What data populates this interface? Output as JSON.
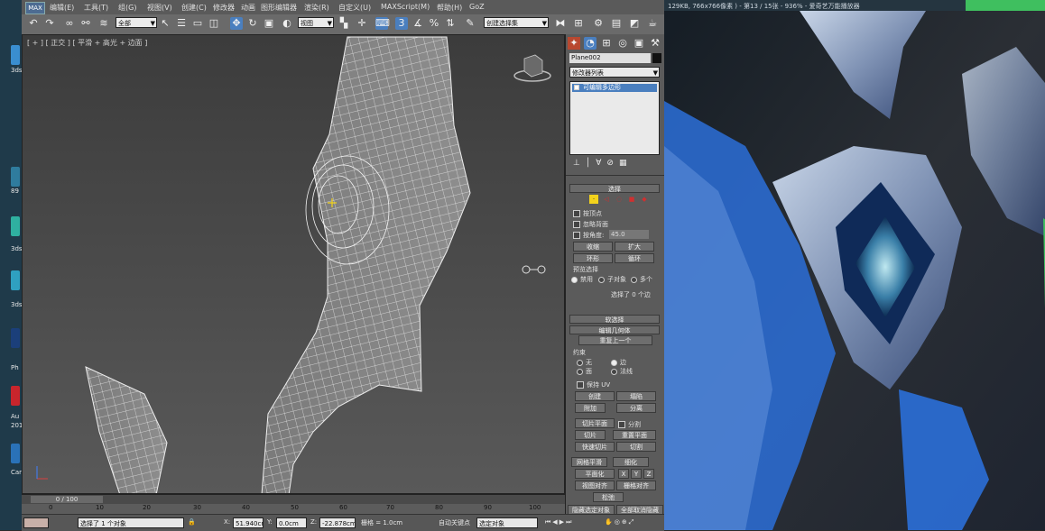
{
  "menubar": {
    "logo": "MAX",
    "items": [
      "编辑(E)",
      "工具(T)",
      "组(G)",
      "视图(V)",
      "创建(C)",
      "修改器",
      "动画",
      "图形编辑器",
      "渲染(R)",
      "自定义(U)",
      "MAXScript(M)",
      "帮助(H)",
      "GoZ"
    ]
  },
  "toolbar": {
    "filter_value": "全部",
    "refcoord_value": "视图",
    "selset_value": "创建选择集"
  },
  "viewport": {
    "label": "[ + ] [ 正交 ] [ 平滑 + 高光 + 边面 ]"
  },
  "timeline": {
    "frame_label": "0 / 100",
    "ticks": [
      "0",
      "10",
      "20",
      "30",
      "40",
      "50",
      "60",
      "70",
      "80",
      "90",
      "100"
    ]
  },
  "status": {
    "selected_text": "选择了 1 个对象",
    "x_label": "X:",
    "x_value": "51.940cm",
    "y_label": "Y:",
    "y_value": "0.0cm",
    "z_label": "Z:",
    "z_value": "-22.878cm",
    "grid_text": "栅格 = 1.0cm",
    "autokey_text": "自动关键点",
    "selobj_value": "选定对象"
  },
  "command_panel": {
    "object_name": "Plane002",
    "modifier_list": "修改器列表",
    "stack_item": "可编辑多边形",
    "select_rollout": "选择",
    "by_vertex": "按顶点",
    "ignore_backface": "忽略背面",
    "by_angle": "按角度:",
    "angle_value": "45.0",
    "shrink": "收缩",
    "grow": "扩大",
    "ring": "环形",
    "loop": "循环",
    "preview_select": "预览选择",
    "preview_off": "禁用",
    "preview_subobj": "子对象",
    "preview_multi": "多个",
    "selected_edges": "选择了 0 个边",
    "soft_select": "软选择",
    "edit_geometry": "编辑几何体",
    "repeat_last": "重复上一个",
    "constraints": "约束",
    "c_none": "无",
    "c_edge": "边",
    "c_face": "面",
    "c_normal": "法线",
    "preserve_uv": "保持 UV",
    "create": "创建",
    "collapse": "塌陷",
    "attach": "附加",
    "detach": "分离",
    "slice_plane": "切片平面",
    "split": "分割",
    "slice": "切片",
    "reset_plane": "重置平面",
    "quickslice": "快速切片",
    "cut": "切割",
    "meshsmooth": "网格平滑",
    "tessellate": "细化",
    "make_planar": "平面化",
    "x": "X",
    "y": "Y",
    "z": "Z",
    "view_align": "视图对齐",
    "grid_align": "栅格对齐",
    "relax": "松弛",
    "hide_selected": "隐藏选定对象",
    "unhide_all": "全部取消隐藏"
  },
  "viewer": {
    "title": "129KB, 766x766像素 ) - 第13 / 15张 - 936% - 爱奇艺万能播放器"
  },
  "desktop": {
    "labels": [
      "3ds",
      "89",
      "3ds",
      "3ds",
      "Ph",
      "Au",
      "201",
      "Car"
    ]
  },
  "colors": {
    "select_accent": "#f2d21c",
    "max_blue": "#4a7fbf",
    "viewer_blue": "#2b6fd8"
  }
}
